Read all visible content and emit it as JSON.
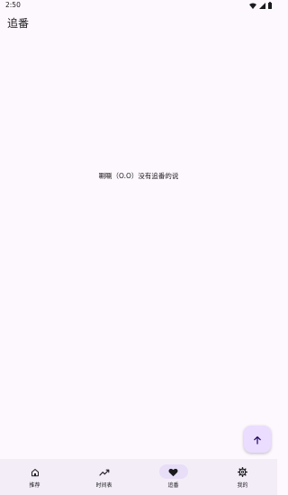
{
  "status_bar": {
    "time": "2:50",
    "icons": [
      "wifi-icon",
      "signal-icon",
      "battery-icon"
    ]
  },
  "app_bar": {
    "title": "追番"
  },
  "main": {
    "empty_message": "唰唰（O.O）没有追番的说"
  },
  "fab": {
    "icon": "arrow-up-icon"
  },
  "bottom_nav": {
    "items": [
      {
        "label": "推荐",
        "icon": "home-icon",
        "active": false
      },
      {
        "label": "时间表",
        "icon": "trending-icon",
        "active": false
      },
      {
        "label": "追番",
        "icon": "heart-icon",
        "active": true
      },
      {
        "label": "我的",
        "icon": "gear-icon",
        "active": false
      }
    ]
  },
  "colors": {
    "background": "#fdf8fd",
    "nav_background": "#f3edf7",
    "active_indicator": "#e8def8",
    "fab_background": "#eaddff",
    "text": "#1c1b1f"
  }
}
